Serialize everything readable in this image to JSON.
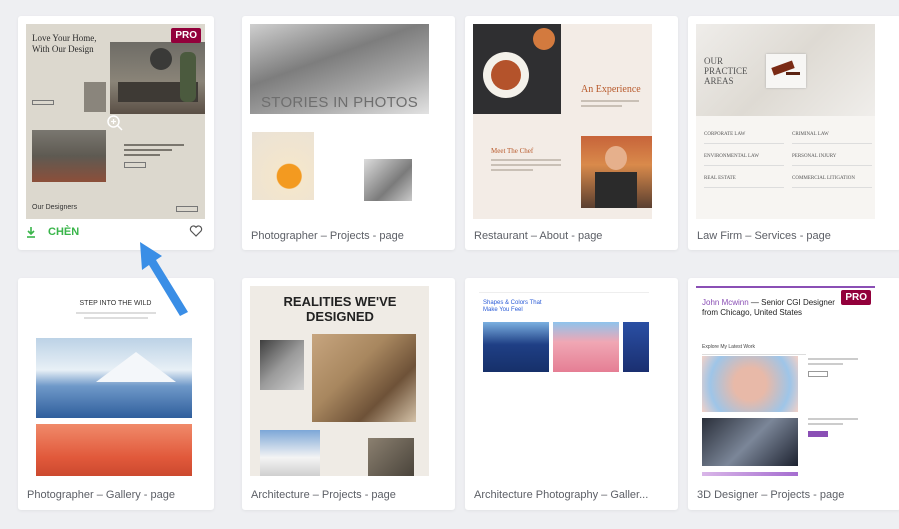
{
  "templates": [
    {
      "label": "",
      "pro": "PRO",
      "insert_label": "CHÈN",
      "thumb_title": "Love Your Home, With Our Design",
      "thumb_footer": "Our Designers"
    },
    {
      "label": "Photographer – Projects - page",
      "thumb_title": "STORIES IN PHOTOS"
    },
    {
      "label": "Restaurant – About - page",
      "thumb_title": "An Experience",
      "thumb_sub": "Meet The Chef"
    },
    {
      "label": "Law Firm – Services - page",
      "thumb_title": "OUR PRACTICE AREAS",
      "services": [
        "CORPORATE LAW",
        "CRIMINAL LAW",
        "ENVIRONMENTAL LAW",
        "PERSONAL INJURY",
        "REAL ESTATE",
        "COMMERCIAL LITIGATION"
      ]
    },
    {
      "label": "Photographer – Gallery - page",
      "thumb_title": "STEP INTO THE WILD"
    },
    {
      "label": "Architecture – Projects - page",
      "thumb_title": "REALITIES WE'VE DESIGNED"
    },
    {
      "label": "Architecture Photography – Galler...",
      "thumb_title": "Shapes & Colors That Make You Feel"
    },
    {
      "label": "3D Designer – Projects - page",
      "pro": "PRO",
      "thumb_name": "John Mcwinn",
      "thumb_title": "— Senior CGI Designer from Chicago, United States",
      "thumb_sub": "Explore My Latest Work"
    }
  ],
  "colors": {
    "pro": "#92003b",
    "insert": "#39b54a",
    "arrow": "#3a8ee6"
  }
}
